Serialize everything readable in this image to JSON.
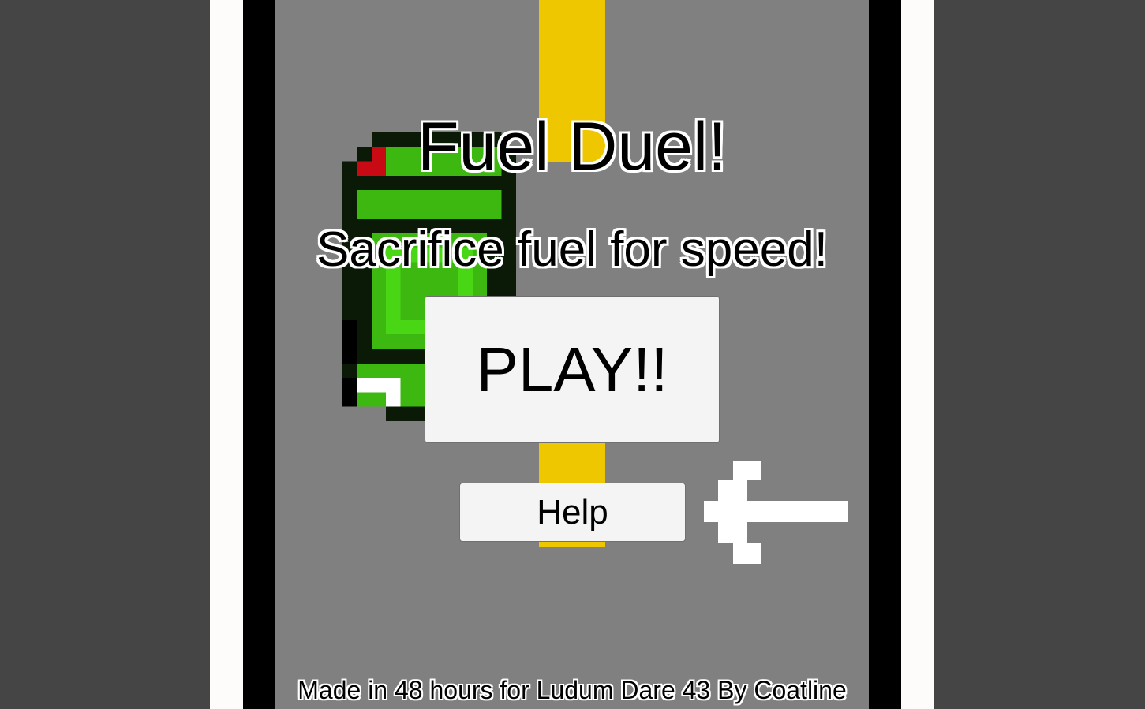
{
  "game": {
    "title": "Fuel Duel!",
    "subtitle": "Sacrifice fuel for speed!",
    "credits": "Made in 48 hours for Ludum Dare 43 By Coatline"
  },
  "buttons": {
    "play_label": "PLAY!!",
    "help_label": "Help"
  },
  "sprites": {
    "car": "green-car-sprite",
    "pointer": "white-arrow-icon"
  },
  "colors": {
    "background": "#454545",
    "road": "#808080",
    "lane_marking": "#eec700",
    "road_edge_black": "#000000",
    "road_edge_white": "#fdfcfb",
    "car_green": "#3cb811",
    "car_dark": "#0b1a06",
    "car_light": "#49d614",
    "taillight_red": "#c80a14",
    "button_bg": "#f4f4f4"
  }
}
